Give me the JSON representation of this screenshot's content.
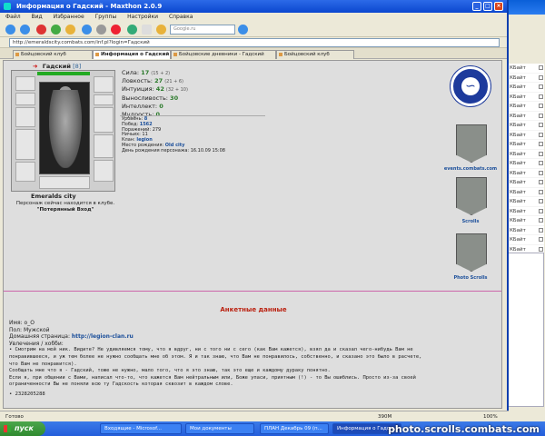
{
  "window": {
    "title": "Информация о Гадский - Maxthon 2.0.9",
    "menu": [
      "Файл",
      "Вид",
      "Избранное",
      "Группы",
      "Настройки",
      "Справка"
    ],
    "search_placeholder": "Google.ru",
    "address": "http://emeraldscity.combats.com/inf.pl?login=Гадский"
  },
  "tabs": [
    {
      "label": "Бойцовский клуб"
    },
    {
      "label": "Информация о Гадский"
    },
    {
      "label": "Бойцовские дневники - Гадский"
    },
    {
      "label": "Бойцовский клуб"
    }
  ],
  "character": {
    "name": "Гадский",
    "level_tag": "[8]",
    "hp_text": "351/351",
    "city": "Emeralds city",
    "presence_line1": "Персонаж сейчас находится в клубе.",
    "presence_line2": "\"Потерянный Вход\""
  },
  "stats": [
    {
      "label": "Сила:",
      "value": "17",
      "bonus": "(15 + 2)"
    },
    {
      "label": "Ловкость:",
      "value": "27",
      "bonus": "(21 + 6)"
    },
    {
      "label": "Интуиция:",
      "value": "42",
      "bonus": "(32 + 10)"
    },
    {
      "label": "Выносливость:",
      "value": "30",
      "bonus": ""
    },
    {
      "label": "Интеллект:",
      "value": "0",
      "bonus": ""
    },
    {
      "label": "Мудрость:",
      "value": "0",
      "bonus": ""
    }
  ],
  "info": [
    {
      "label": "Уровень:",
      "value": "8"
    },
    {
      "label": "Побед:",
      "value": "1562"
    },
    {
      "label": "Поражений:",
      "value": "279"
    },
    {
      "label": "Ничьих:",
      "value": "11"
    },
    {
      "label": "Клан:",
      "value": "legion"
    },
    {
      "label": "Место рождения:",
      "value": "Old city"
    },
    {
      "label": "День рождения персонажа:",
      "value": "16.10.09 15:08"
    }
  ],
  "emblems": {
    "events_label": "events.combats.com",
    "scrolls_label": "Scrolls",
    "photo_label": "Photo Scrolls"
  },
  "profile": {
    "section_title": "Анкетные данные",
    "name_line": "Имя: o_O",
    "gender_line": "Пол: Мужской",
    "homepage_label": "Домашняя страница:",
    "homepage_url": "http://legion-clan.ru",
    "hobby_label": "Увлечения / хобби:",
    "about": "• Смотрим на мой ник. Видите? Не удивляемся тому, что я вдруг, ни с того ни с сего (как Вам кажется), взял да и сказал чего-нибудь Вам не\nпонравившееся, и уж тем более не нужно сообщать мне об этом. Я и так знаю, что Вам не понравилось, собственно, и сказано это было в расчете,\nчто Вам не понравится).\nСообщать мне что я - Гадский, тоже не нужно, мало того, что я это знаю, так это еще и каждому дураку понятно.\nЕсли я, при общении с Вами, написал что-то, что кажется Вам нейтральным или, Боже упаси, приятным (!) - то Вы ошиблись. Просто из-за своей\nограниченности Вы не поняли всю ту Гадскость которая сквозит в каждом слове.",
    "icq": "• 2328205288"
  },
  "status": {
    "left": "Готово",
    "mem": "390M",
    "zoom": "100%"
  },
  "background_window": {
    "rows": [
      "КБайт",
      "КБайт",
      "КБайт",
      "КБайт",
      "КБайт",
      "КБайт",
      "КБайт",
      "КБайт",
      "КБайт",
      "КБайт",
      "КБайт",
      "КБайт",
      "КБайт",
      "КБайт",
      "КБайт",
      "КБайт",
      "КБайт",
      "КБайт",
      "КБайт",
      "КБайт"
    ]
  },
  "taskbar": {
    "start": "пуск",
    "tasks": [
      "Входящие - Microsof...",
      "Мои документы",
      "ПЛАН Декабрь 09 (п...",
      "Информация о Гадск..."
    ],
    "watermark": "photo.scrolls.combats.com"
  }
}
